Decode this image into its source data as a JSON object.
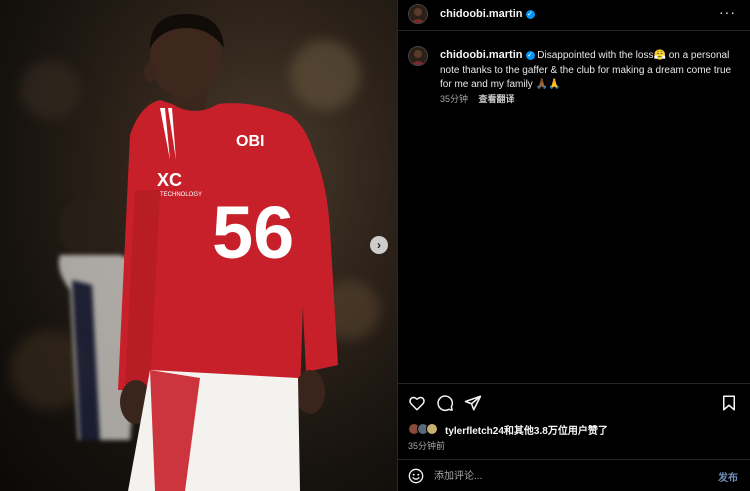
{
  "post": {
    "username": "chidoobi.martin",
    "verified_mark": "✓",
    "more_label": "···",
    "next_label": "›"
  },
  "caption": {
    "username": "chidoobi.martin",
    "text": "Disappointed with the loss😤 on a personal note thanks to the gaffer & the club for making a dream come true for me and my family 🙏🏾🙏",
    "time": "35分钟",
    "translate_label": "查看翻译"
  },
  "media": {
    "jersey_name": "OBI",
    "jersey_number": "56",
    "sponsor": "XC",
    "sponsor_sub": "TECHNOLOGY"
  },
  "actions": {
    "like_icon": "heart-icon",
    "comment_icon": "comment-icon",
    "share_icon": "share-icon",
    "save_icon": "bookmark-icon"
  },
  "likes": {
    "text": "tylerfletch24和其他3.8万位用户赞了"
  },
  "post_time": "35分钟前",
  "comment": {
    "placeholder": "添加评论...",
    "post_label": "发布"
  },
  "colors": {
    "background": "#000000",
    "verified": "#0095f6",
    "jersey_red": "#c8202a",
    "post_button": "#6f8fb8"
  }
}
